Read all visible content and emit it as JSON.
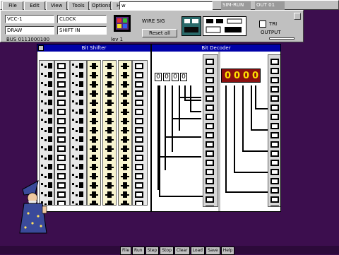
{
  "menubar": {
    "items": [
      "File",
      "Edit",
      "View",
      "Tools",
      "Options",
      "Help"
    ],
    "path_field": "w",
    "right_text": "SIM-RUN",
    "right_text2": "OUT 01"
  },
  "controls": {
    "field1": "VCC-1",
    "field2": "CLOCK",
    "field3": "DRAW",
    "field4": "SHIFT IN",
    "status_left": "BUS 0111000100",
    "status_right": "lev 1",
    "label_a": "WIRE SIG",
    "button_a": "Reset all",
    "label_b": "TRI",
    "label_c": "OUTPUT"
  },
  "windows": {
    "shift": {
      "title": "Bit Shifter"
    },
    "decoder": {
      "title": "Bit Decoder"
    }
  },
  "readout": {
    "left": [
      "0",
      "0",
      "0",
      "0"
    ],
    "right": [
      "0",
      "0",
      "0",
      "0"
    ]
  },
  "taskbar": {
    "items": [
      "File",
      "Run",
      "Step",
      "Stop",
      "Clear",
      "Load",
      "Save",
      "Help"
    ]
  },
  "colors": {
    "desktop": "#3c0e4e",
    "title_active": "#0000a8",
    "readout_bg": "#8a1010",
    "readout_fg": "#ffe000"
  }
}
